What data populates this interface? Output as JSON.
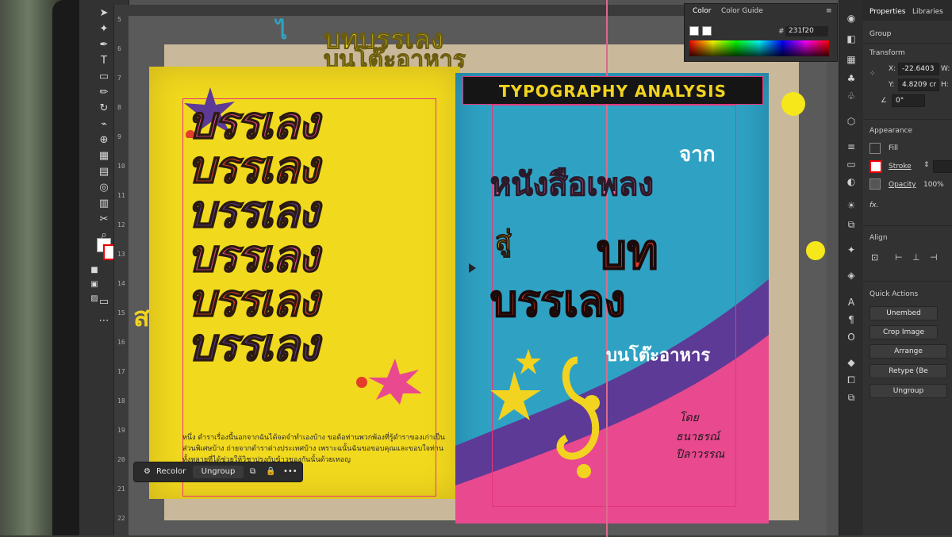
{
  "color_panel": {
    "tab_color": "Color",
    "tab_guide": "Color Guide",
    "hex_symbol": "#",
    "hex_value": "231f20"
  },
  "properties": {
    "tab_properties": "Properties",
    "tab_libraries": "Libraries",
    "selection_type": "Group",
    "transform_heading": "Transform",
    "x_label": "X:",
    "x_value": "-22.6403",
    "y_label": "Y:",
    "y_value": "4.8209 cr",
    "w_label": "W:",
    "h_label": "H:",
    "angle_value": "0°",
    "appearance_heading": "Appearance",
    "fill_label": "Fill",
    "stroke_label": "Stroke",
    "opacity_label": "Opacity",
    "opacity_value": "100%",
    "fx_label": "fx.",
    "align_heading": "Align",
    "quick_actions_heading": "Quick Actions",
    "btn_unembed": "Unembed",
    "btn_crop_image": "Crop Image",
    "btn_arrange": "Arrange",
    "btn_retype": "Retype (Be",
    "btn_ungroup": "Ungroup"
  },
  "context_bar": {
    "recolor": "Recolor",
    "ungroup": "Ungroup",
    "more": "•••"
  },
  "artwork": {
    "banner_title": "TYPOGRAPHY ANALYSIS",
    "left_repeat_word": "บรรเลง",
    "right_from": "จาก",
    "right_line1": "หนังสือเพลง",
    "right_to": "สู่",
    "right_line2_small": "บท",
    "right_line2_big": "บรรเลง",
    "right_subtitle": "บนโต๊ะอาหาร",
    "right_author_by": "โดย",
    "right_author_name1": "ธนาธรณ์",
    "right_author_name2": "ปิลาวรรณ",
    "top_title_line1": "บทบรรเลง",
    "top_title_line2": "บนโต๊ะอาหาร",
    "body_text": "หนึ่ง ตำราเรื่องนี้นอกจากฉันได้จดจำทำเองบ้าง ขอต้อท่านพวกพ้องที่รู้ตำราของเก่าเป็นส่วนพิเศษบ้าง ถ่ายจากตำราต่างประเทศบ้าง เพราะฉนั้นฉันขอขอบคุณและขอบใจท่านทั้งหลายที่ได้ช่วยให้วิชาปรุงกับข้าวของกันนั้นด้วยเทอญ"
  },
  "ruler_numbers": [
    "5",
    "6",
    "7",
    "8",
    "9",
    "10",
    "11",
    "12",
    "13",
    "14",
    "15",
    "16",
    "17",
    "18",
    "19",
    "20",
    "21",
    "22"
  ],
  "colors": {
    "yellow": "#f1d91e",
    "cyan": "#2fa2c4",
    "pink": "#e8498f",
    "red": "#e23e2a",
    "purple": "#5d3a96"
  }
}
